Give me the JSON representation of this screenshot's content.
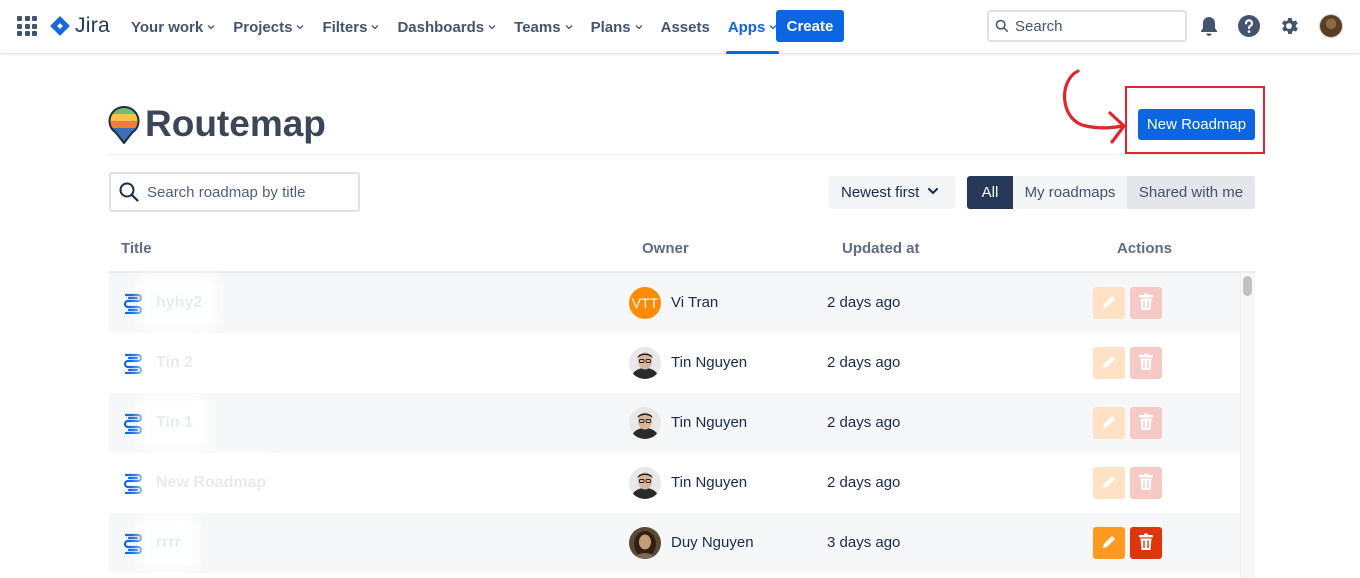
{
  "topnav": {
    "logo_text": "Jira",
    "items": [
      {
        "label": "Your work",
        "dropdown": true
      },
      {
        "label": "Projects",
        "dropdown": true
      },
      {
        "label": "Filters",
        "dropdown": true
      },
      {
        "label": "Dashboards",
        "dropdown": true
      },
      {
        "label": "Teams",
        "dropdown": true
      },
      {
        "label": "Plans",
        "dropdown": true
      },
      {
        "label": "Assets",
        "dropdown": false
      },
      {
        "label": "Apps",
        "dropdown": true,
        "active": true
      }
    ],
    "create_label": "Create",
    "search_placeholder": "Search",
    "icons": [
      "app-switcher-icon",
      "notifications-icon",
      "help-icon",
      "settings-icon",
      "profile-avatar"
    ]
  },
  "page": {
    "title": "Routemap",
    "new_button_label": "New Roadmap",
    "search_placeholder": "Search roadmap by title",
    "sort_label": "Newest first",
    "filters": {
      "all": "All",
      "mine": "My roadmaps",
      "shared": "Shared with me",
      "selected": "All"
    }
  },
  "table": {
    "headers": {
      "title": "Title",
      "owner": "Owner",
      "updated": "Updated at",
      "actions": "Actions"
    },
    "rows": [
      {
        "title": "hyhy2",
        "owner": "Vi Tran",
        "owner_initials": "VTT",
        "updated": "2 days ago",
        "actions_enabled": false
      },
      {
        "title": "Tin 2",
        "owner": "Tin Nguyen",
        "owner_initials": "",
        "updated": "2 days ago",
        "actions_enabled": false
      },
      {
        "title": "Tin 1",
        "owner": "Tin Nguyen",
        "owner_initials": "",
        "updated": "2 days ago",
        "actions_enabled": false
      },
      {
        "title": "New Roadmap",
        "owner": "Tin Nguyen",
        "owner_initials": "",
        "updated": "2 days ago",
        "actions_enabled": false
      },
      {
        "title": "rrrr",
        "owner": "Duy Nguyen",
        "owner_initials": "",
        "updated": "3 days ago",
        "actions_enabled": true
      }
    ]
  },
  "colors": {
    "brand": "#0c66e4",
    "annotation": "#e3242b",
    "edit": "#ff991f",
    "delete": "#de350b"
  }
}
